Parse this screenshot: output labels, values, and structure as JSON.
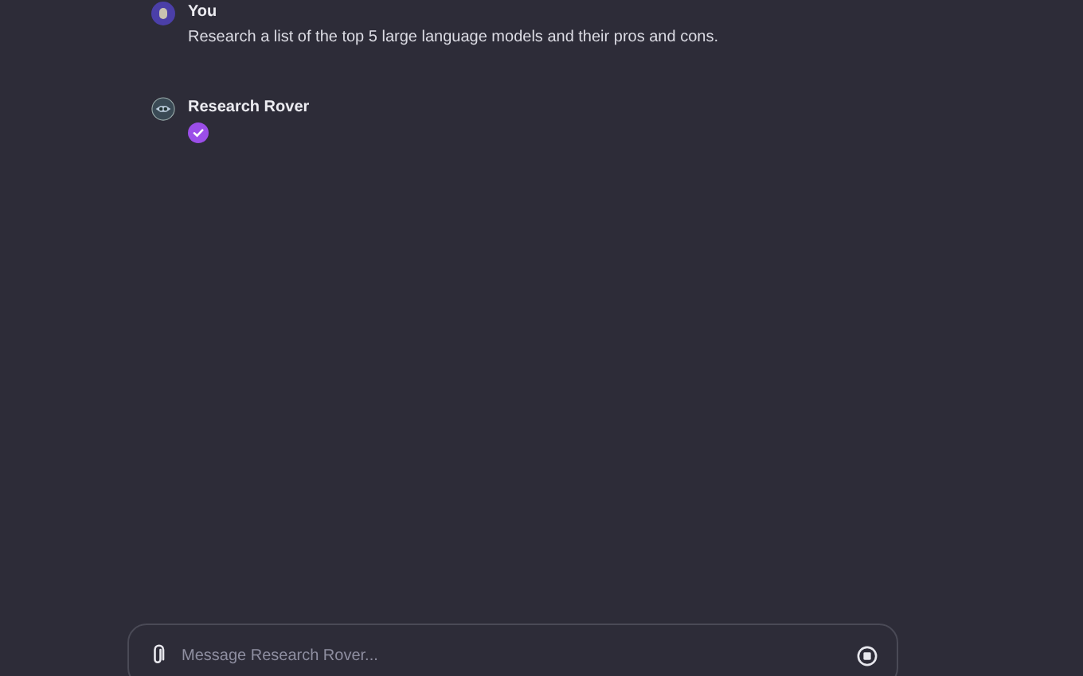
{
  "messages": [
    {
      "kind": "user",
      "sender": "You",
      "text": "Research a list of the top 5 large language models and their pros and cons."
    },
    {
      "kind": "assistant",
      "sender": "Research Rover"
    }
  ],
  "composer": {
    "placeholder": "Message Research Rover..."
  }
}
